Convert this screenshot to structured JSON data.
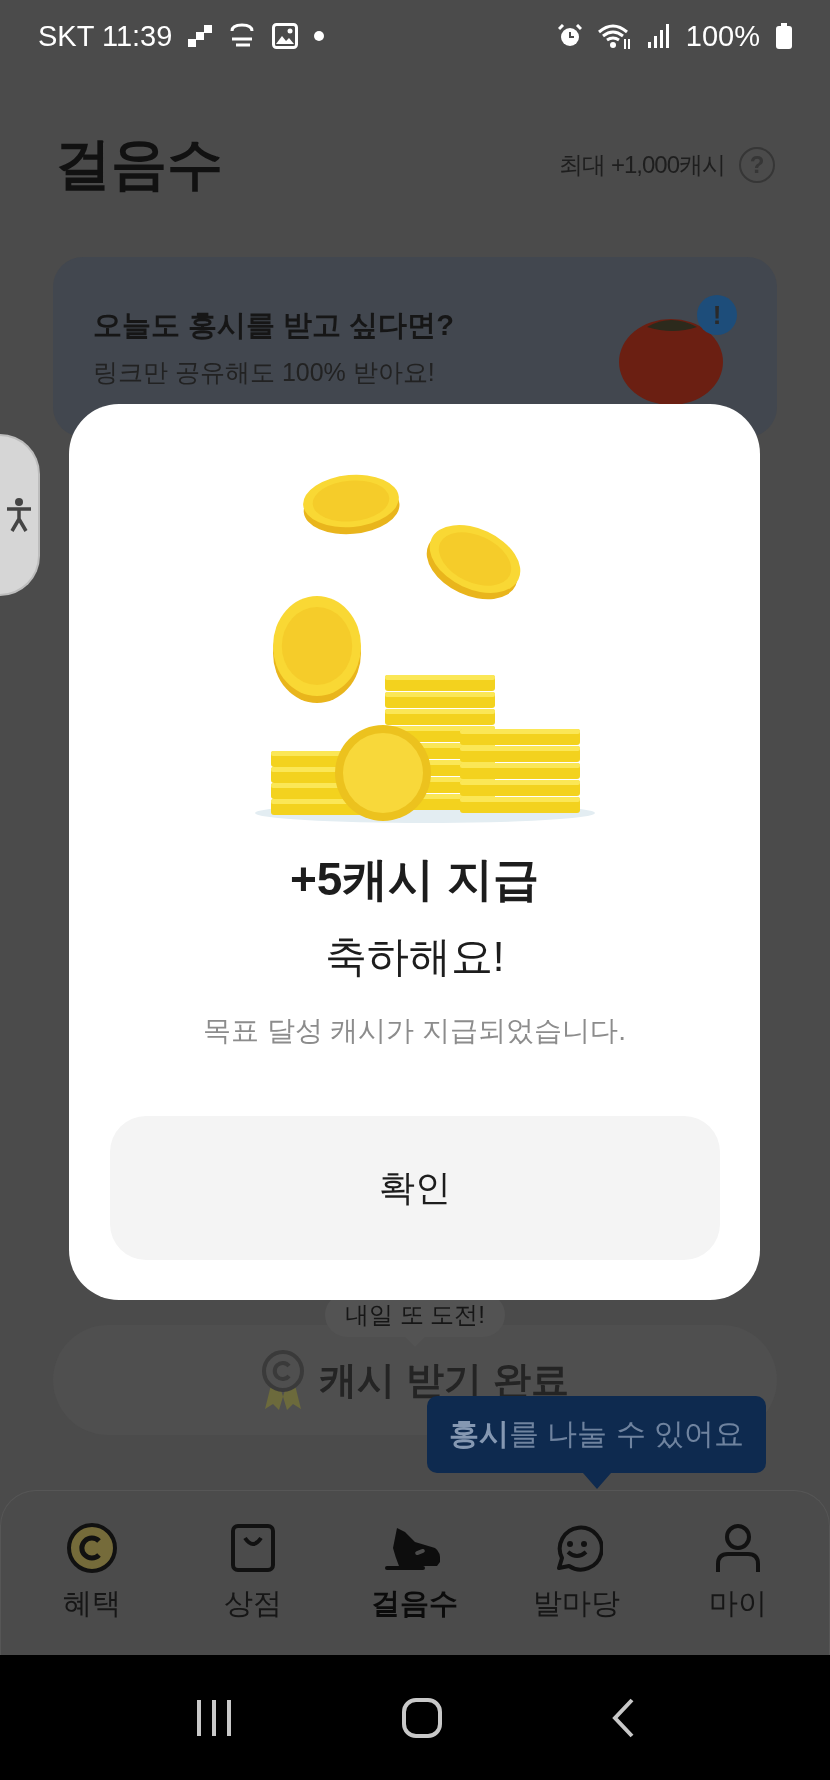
{
  "status_bar": {
    "carrier_time": "SKT 11:39",
    "battery": "100%"
  },
  "header": {
    "title": "걸음수",
    "max_reward": "최대 +1,000캐시",
    "help": "?"
  },
  "banner": {
    "title": "오늘도 홍시를 받고 싶다면?",
    "subtitle": "링크만 공유해도 100% 받아요!",
    "badge": "!"
  },
  "challenge": {
    "bubble": "내일 또 도전!",
    "status": "캐시 받기 완료"
  },
  "tooltip": "**홍시**를 나눌 수 있어요",
  "nav": [
    {
      "label": "혜택",
      "kind": "coin",
      "selected": false
    },
    {
      "label": "상점",
      "kind": "bag",
      "selected": false
    },
    {
      "label": "걸음수",
      "kind": "shoe",
      "selected": true
    },
    {
      "label": "발마당",
      "kind": "chat",
      "selected": false
    },
    {
      "label": "마이",
      "kind": "person",
      "selected": false
    }
  ],
  "modal": {
    "title": "+5캐시 지급",
    "heading": "축하해요!",
    "message": "목표 달성 캐시가 지급되었습니다.",
    "button": "확인"
  }
}
